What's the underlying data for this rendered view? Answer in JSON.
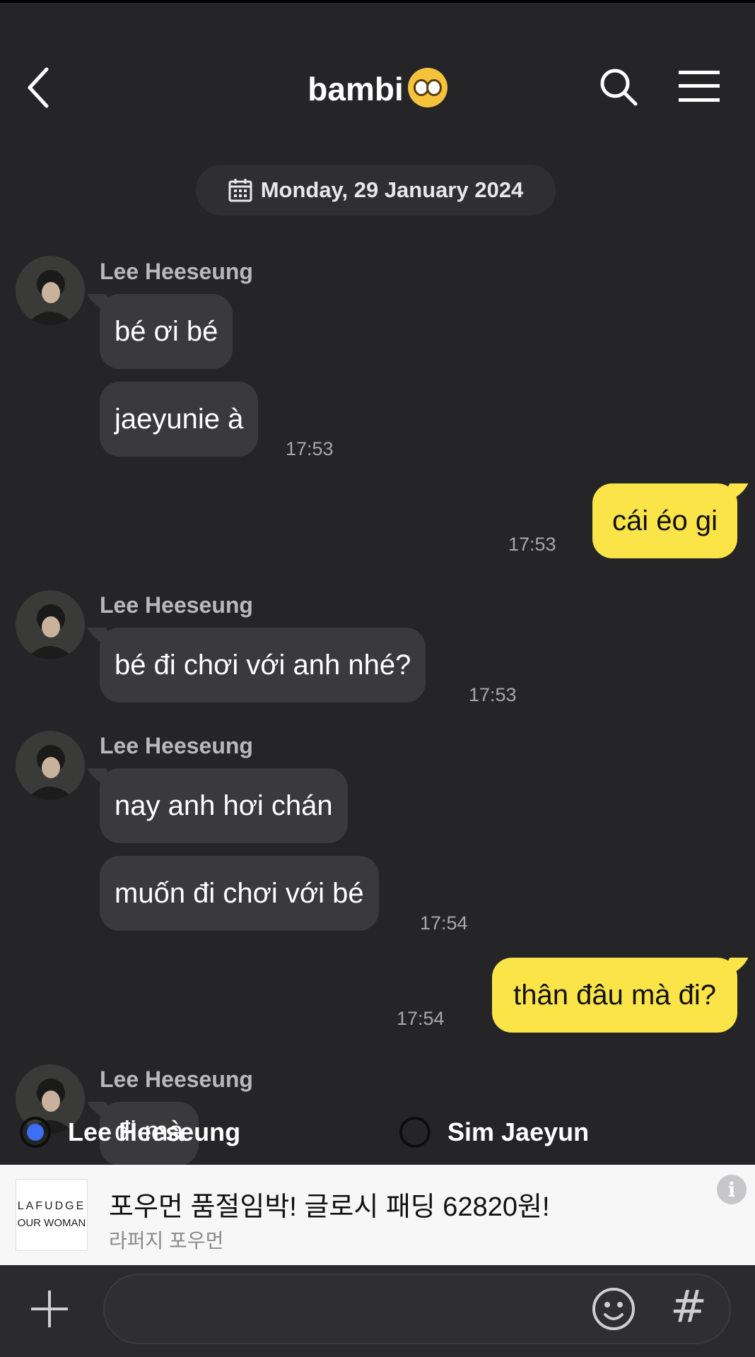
{
  "header": {
    "title": "bambi"
  },
  "date_separator": "Monday, 29 January 2024",
  "messages": [
    {
      "sender": "Lee Heeseung",
      "lines": [
        "bé ơi bé",
        "jaeyunie à"
      ],
      "time": "17:53"
    },
    {
      "own": true,
      "text": "cái éo gi",
      "time": "17:53"
    },
    {
      "sender": "Lee Heeseung",
      "lines": [
        "bé đi chơi với anh nhé?"
      ],
      "time": "17:53"
    },
    {
      "sender": "Lee Heeseung",
      "lines": [
        "nay anh hơi chán",
        "muốn đi chơi với bé"
      ],
      "time": "17:54"
    },
    {
      "own": true,
      "text": "thân đâu mà đi?",
      "time": "17:54"
    },
    {
      "sender": "Lee Heeseung",
      "lines": [
        "đi mà"
      ]
    }
  ],
  "poll": {
    "options": [
      {
        "label": "Lee Heeseung",
        "selected": true
      },
      {
        "label": "Sim Jaeyun",
        "selected": false
      }
    ]
  },
  "ad": {
    "logo_line1": "LAFUDGE",
    "logo_line2": "OUR WOMAN",
    "title": "포우먼 품절임박! 글로시 패딩 62820원!",
    "subtitle": "라퍼지 포우먼"
  },
  "colors": {
    "background": "#252527",
    "own_bubble": "#fbe447",
    "other_bubble": "#3a3a3d",
    "radio_selected": "#3d6ff2"
  }
}
